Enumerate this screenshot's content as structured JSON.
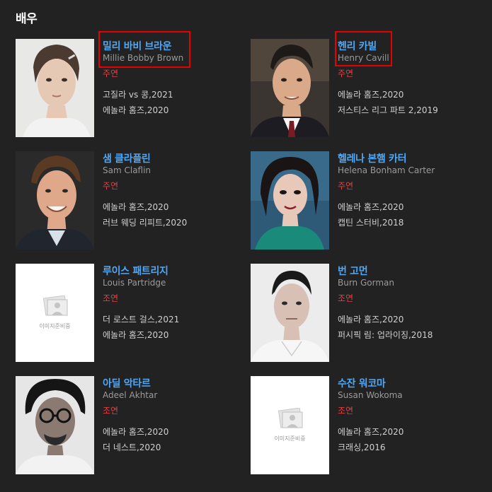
{
  "section": {
    "title": "배우"
  },
  "actors": [
    {
      "name_ko": "밀리 바비 브라운",
      "name_en": "Millie Bobby Brown",
      "role": "주연",
      "works": [
        "고질라 vs 콩,2021",
        "에놀라 홈즈,2020"
      ],
      "photo": "portrait",
      "highlighted": true
    },
    {
      "name_ko": "헨리 카빌",
      "name_en": "Henry Cavill",
      "role": "주연",
      "works": [
        "에놀라 홈즈,2020",
        "저스티스 리그 파트 2,2019"
      ],
      "photo": "portrait",
      "highlighted": true
    },
    {
      "name_ko": "샘 클라플린",
      "name_en": "Sam Claflin",
      "role": "주연",
      "works": [
        "에놀라 홈즈,2020",
        "러브 웨딩 리피트,2020"
      ],
      "photo": "portrait",
      "highlighted": false
    },
    {
      "name_ko": "헬레나 본햄 카터",
      "name_en": "Helena Bonham Carter",
      "role": "주연",
      "works": [
        "에놀라 홈즈,2020",
        "캡틴 스터비,2018"
      ],
      "photo": "portrait",
      "highlighted": false
    },
    {
      "name_ko": "루이스 패트리지",
      "name_en": "Louis Partridge",
      "role": "조연",
      "works": [
        "더 로스트 걸스,2021",
        "에놀라 홈즈,2020"
      ],
      "photo": "placeholder",
      "placeholder_text": "이미지준비중",
      "highlighted": false
    },
    {
      "name_ko": "번 고먼",
      "name_en": "Burn Gorman",
      "role": "조연",
      "works": [
        "에놀라 홈즈,2020",
        "퍼시픽 림: 업라이징,2018"
      ],
      "photo": "portrait",
      "highlighted": false
    },
    {
      "name_ko": "아딜 악타르",
      "name_en": "Adeel Akhtar",
      "role": "조연",
      "works": [
        "에놀라 홈즈,2020",
        "더 네스트,2020"
      ],
      "photo": "portrait",
      "highlighted": false
    },
    {
      "name_ko": "수잔 워코마",
      "name_en": "Susan Wokoma",
      "role": "조연",
      "works": [
        "에놀라 홈즈,2020",
        "크래싱,2016"
      ],
      "photo": "placeholder",
      "placeholder_text": "이미지준비중",
      "highlighted": false
    }
  ],
  "colors": {
    "background": "#222222",
    "name": "#4fa7f5",
    "role": "#e04040",
    "highlight": "#e60000"
  }
}
